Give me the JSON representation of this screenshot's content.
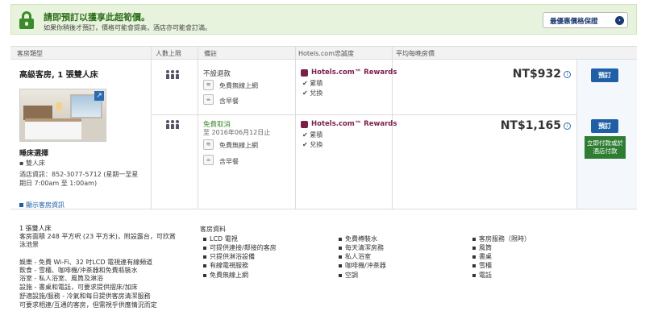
{
  "banner": {
    "title": "請即預訂以獲享此超筍價。",
    "subtitle": "如果你稍後才預訂，價格可能會提高，酒店亦可能會訂滿。",
    "guarantee_label": "最優惠價格保證",
    "guarantee_icon": "chevron-right-icon",
    "accent": "#3c8a2c"
  },
  "table_headers": [
    "客房類型",
    "人數上限",
    "備註",
    "Hotels.com忠誠度",
    "平均每晚房價"
  ],
  "room": {
    "title": "高級客房, 1 張雙人床",
    "bed_label": "睡床選擇",
    "bed_item": "雙人床",
    "hotel_info": "酒店資訊：852-3077-5712 (星期一至星期日 7:00am 至 1:00am)",
    "show_info": "顯示客房資訊"
  },
  "rates": [
    {
      "condition": "不設退款",
      "condition_type": "noref",
      "date": "",
      "amenities": [
        "免費無線上網",
        "含早餐"
      ],
      "rewards": "Hotels.com™ Rewards",
      "rewards_items": [
        "累積",
        "兌換"
      ],
      "price": "NT$932",
      "book_label": "預訂"
    },
    {
      "condition": "免費取消",
      "condition_type": "free",
      "date": "至 2016年06月12日止",
      "amenities": [
        "免費無線上網",
        "含早餐"
      ],
      "rewards": "Hotels.com™ Rewards",
      "rewards_items": [
        "累積",
        "兌換"
      ],
      "price": "NT$1,165",
      "book_label": "預訂",
      "pay_note": "立即付款或於酒店付款"
    }
  ],
  "details": {
    "title": "1 張雙人床",
    "lines_a": [
      "客房面積 248 平方呎 (23 平方米)，附設露台，可欣賞",
      "泳池景"
    ],
    "lines_b": [
      "娛樂 - 免費 Wi-Fi、32 吋LCD 電視連有線頻道",
      "飲食 - 雪櫃、咖啡機/沖茶器和免費瓶裝水",
      "浴室 - 私人浴室、風筒及淋浴",
      "設施 - 書桌和電話，可要求提供摺床/加床",
      "舒適設施/服務 - 冷氣和每日提供客房清潔服務",
      "可要求相連/互通的客房，但需視乎供應情況而定"
    ],
    "features_head": "客房資料",
    "features_col1": [
      "LCD 電視",
      "可提供連接/鄰接的客房",
      "只提供淋浴設備",
      "有線電視服務",
      "免費無線上網"
    ],
    "features_col2": [
      "免費樽裝水",
      "每天清潔房務",
      "私人浴室",
      "咖啡機/沖茶器",
      "空調"
    ],
    "features_col3": [
      "客房服務（限時）",
      "風筒",
      "書桌",
      "雪櫃",
      "電話"
    ]
  }
}
